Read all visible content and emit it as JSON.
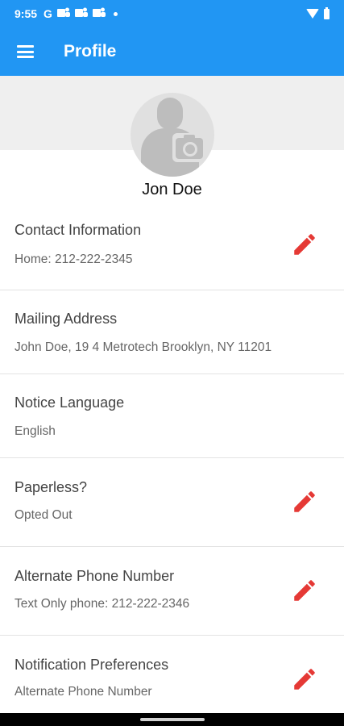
{
  "status_bar": {
    "time": "9:55",
    "google_glyph": "G",
    "icons": [
      "wifi-icon",
      "battery-icon"
    ]
  },
  "app_bar": {
    "title": "Profile",
    "menu_icon": "hamburger-menu-icon"
  },
  "profile": {
    "name": "Jon Doe",
    "avatar_icon": "person-camera-icon"
  },
  "sections": [
    {
      "label": "Contact Information",
      "value": "Home: 212-222-2345",
      "editable": true
    },
    {
      "label": "Mailing Address",
      "value": "John Doe, 19 4 Metrotech Brooklyn, NY 11201",
      "editable": false
    },
    {
      "label": "Notice Language",
      "value": "English",
      "editable": false
    },
    {
      "label": "Paperless?",
      "value": "Opted Out",
      "editable": true
    },
    {
      "label": "Alternate Phone Number",
      "value": "Text Only phone: 212-222-2346",
      "editable": true
    },
    {
      "label": "Notification Preferences",
      "value": "Alternate Phone Number",
      "editable": true
    }
  ],
  "colors": {
    "primary": "#2196F3",
    "edit_icon": "#E53935",
    "header_band": "#EFEFEF"
  }
}
